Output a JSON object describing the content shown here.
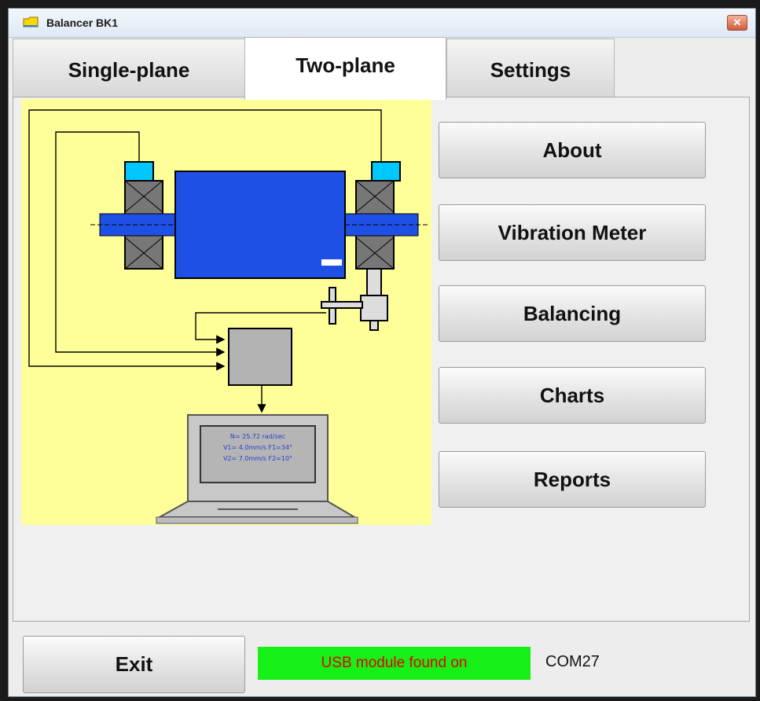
{
  "window": {
    "title": "Balancer BK1",
    "close_label": "✕"
  },
  "tabs": [
    {
      "label": "Single-plane",
      "active": false
    },
    {
      "label": "Two-plane",
      "active": true
    },
    {
      "label": "Settings",
      "active": false
    }
  ],
  "menu": {
    "about": "About",
    "vibration_meter": "Vibration Meter",
    "balancing": "Balancing",
    "charts": "Charts",
    "reports": "Reports"
  },
  "footer": {
    "exit_label": "Exit",
    "status_text": "USB module found on",
    "port": "COM27"
  },
  "diagram": {
    "screen_line1": "N=    25.72 rad/sec",
    "screen_line2": "V1= 4.0mm/s    F1=34°",
    "screen_line3": "V2= 7.0mm/s    F2=10°"
  },
  "colors": {
    "diagram_background": "#ffff99",
    "rotor": "#1e50e6",
    "sensor": "#00c8ff",
    "status_background": "#16f016",
    "status_text": "#e00000"
  },
  "icons": {
    "app": "folder-icon",
    "close": "close-icon"
  }
}
